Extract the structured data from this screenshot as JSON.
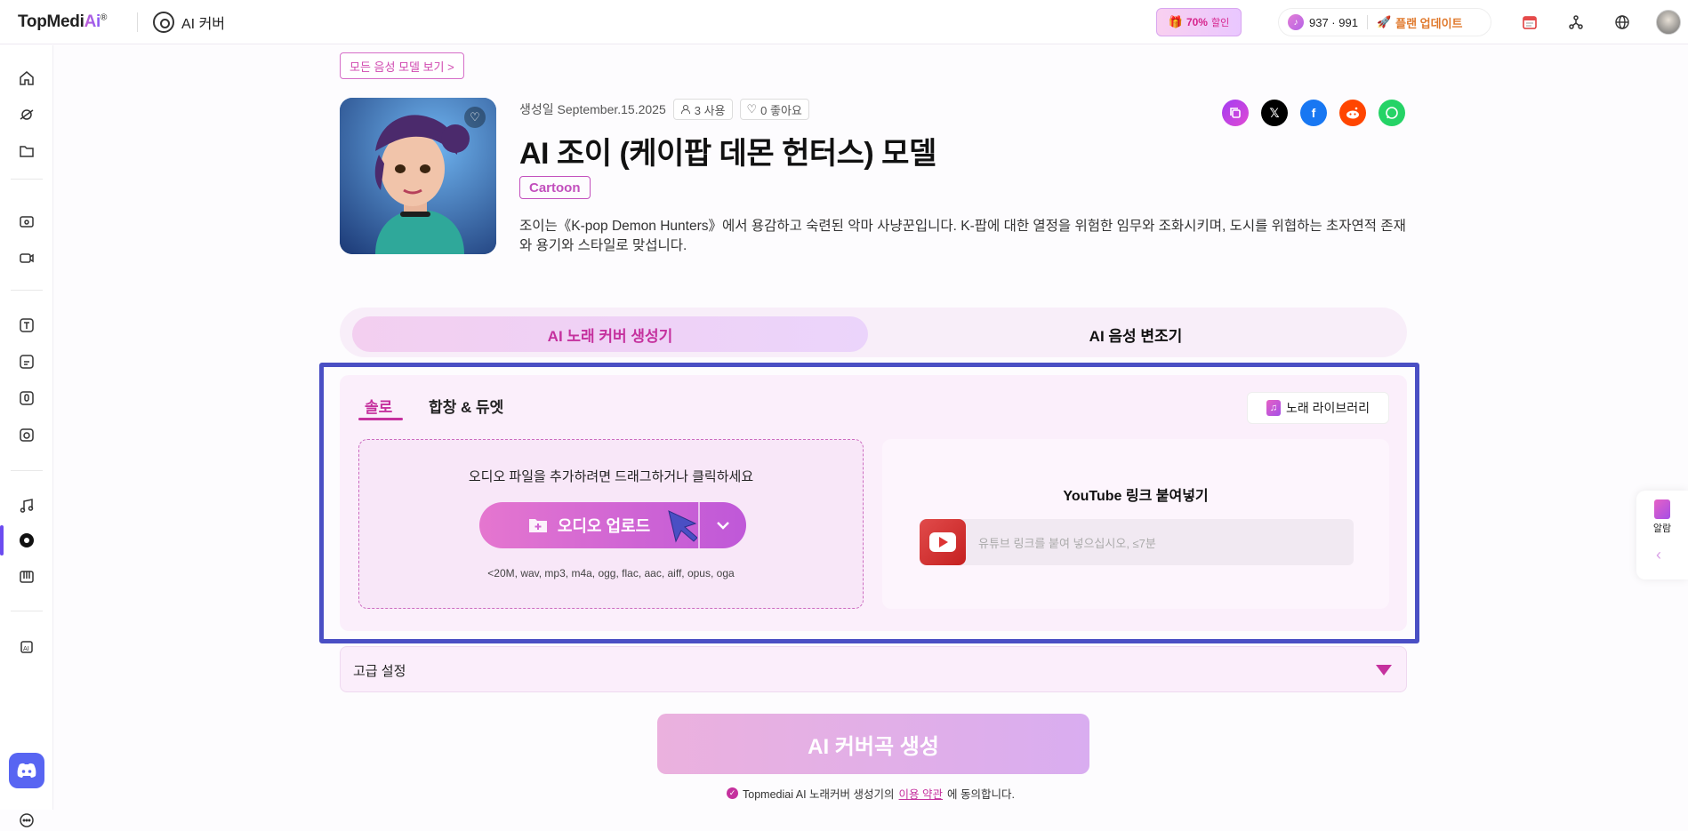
{
  "app": {
    "brand_prefix": "TopMedi",
    "brand_ai": "Ai",
    "brand_reg": "®",
    "section": "AI 커버"
  },
  "header": {
    "promo_percent": "70%",
    "promo_text": "할인",
    "credits": "937 · 991",
    "upgrade": "플랜 업데이트"
  },
  "model": {
    "all_models_link": "모든 음성 모델 보기 >",
    "created": "생성일 September.15.2025",
    "uses": "3 사용",
    "likes": "0 좋아요",
    "title": "AI 조이 (케이팝 데몬 헌터스) 모델",
    "tag": "Cartoon",
    "description": "조이는《K-pop Demon Hunters》에서 용감하고 숙련된 악마 사냥꾼입니다. K-팝에 대한 열정을 위험한 임무와 조화시키며, 도시를 위협하는 초자연적 존재와 용기와 스타일로 맞섭니다."
  },
  "tabs": {
    "active": "AI 노래 커버 생성기",
    "other": "AI 음성 변조기"
  },
  "panel": {
    "subtab_solo": "솔로",
    "subtab_duet": "합창 & 듀엣",
    "library": "노래 라이브러리",
    "drop_text": "오디오 파일을 추가하려면 드래그하거나 클릭하세요",
    "upload_label": "오디오 업로드",
    "formats": "<20M, wav, mp3, m4a, ogg, flac, aac, aiff, opus, oga",
    "youtube_label": "YouTube 링크 붙여넣기",
    "youtube_placeholder": "유튜브 링크를 붙여 넣으십시오, ≤7분"
  },
  "advanced": {
    "label": "고급 설정"
  },
  "generate": {
    "label": "AI 커버곡 생성"
  },
  "agreement": {
    "prefix": "Topmediai AI 노래커버 생성기의",
    "link": "이용 약관",
    "suffix": "에 동의합니다."
  },
  "floating": {
    "label": "알람"
  },
  "colors": {
    "accent": "#c5319e",
    "highlight_box": "#4a4fc4",
    "discord": "#5865f2"
  }
}
